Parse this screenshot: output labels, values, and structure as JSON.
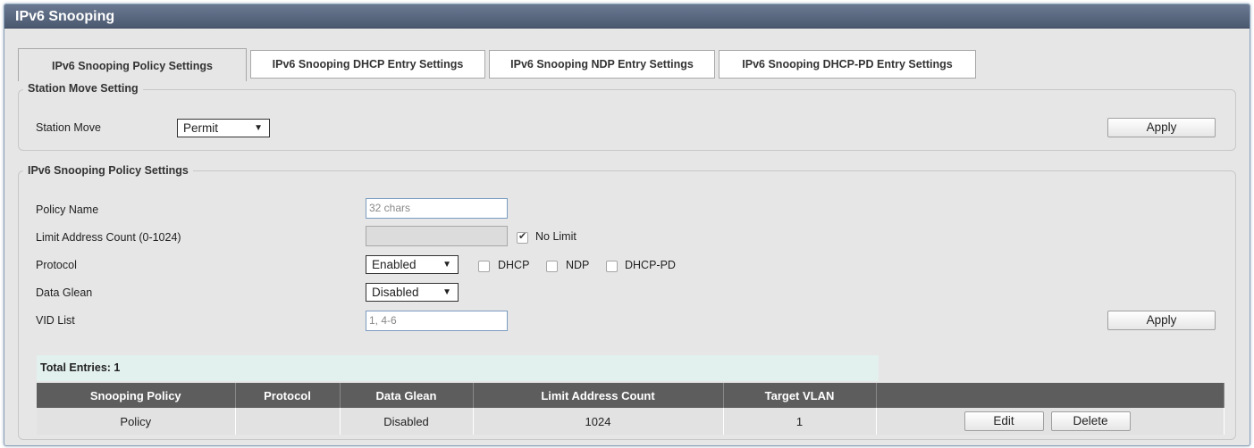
{
  "window": {
    "title": "IPv6 Snooping"
  },
  "tabs": [
    {
      "label": "IPv6 Snooping Policy Settings",
      "active": true
    },
    {
      "label": "IPv6 Snooping DHCP Entry Settings",
      "active": false
    },
    {
      "label": "IPv6 Snooping NDP Entry Settings",
      "active": false
    },
    {
      "label": "IPv6 Snooping DHCP-PD Entry Settings",
      "active": false
    }
  ],
  "station_move": {
    "legend": "Station Move Setting",
    "label": "Station Move",
    "value": "Permit",
    "apply_label": "Apply"
  },
  "policy_settings": {
    "legend": "IPv6 Snooping Policy Settings",
    "policy_name": {
      "label": "Policy Name",
      "placeholder": "32 chars",
      "value": ""
    },
    "limit_address": {
      "label": "Limit Address Count (0-1024)",
      "value": "",
      "no_limit_label": "No Limit",
      "no_limit_checked": true
    },
    "protocol": {
      "label": "Protocol",
      "value": "Enabled",
      "options": [
        {
          "label": "DHCP",
          "checked": false
        },
        {
          "label": "NDP",
          "checked": false
        },
        {
          "label": "DHCP-PD",
          "checked": false
        }
      ]
    },
    "data_glean": {
      "label": "Data Glean",
      "value": "Disabled"
    },
    "vid_list": {
      "label": "VID List",
      "placeholder": "1, 4-6",
      "value": ""
    },
    "apply_label": "Apply"
  },
  "table": {
    "total_entries": "Total Entries: 1",
    "columns": [
      "Snooping Policy",
      "Protocol",
      "Data Glean",
      "Limit Address Count",
      "Target VLAN",
      ""
    ],
    "rows": [
      {
        "policy": "Policy",
        "protocol": "",
        "data_glean": "Disabled",
        "limit": "1024",
        "target_vlan": "1",
        "edit_label": "Edit",
        "delete_label": "Delete"
      }
    ]
  },
  "icons": {
    "dropdown": "chevron-down-icon",
    "checkmark": "check-icon"
  },
  "colors": {
    "titlebar": "#56637a",
    "table_header": "#5d5d5d",
    "panel_bg": "#e6e6e6",
    "total_bar": "#e2f0ee"
  }
}
